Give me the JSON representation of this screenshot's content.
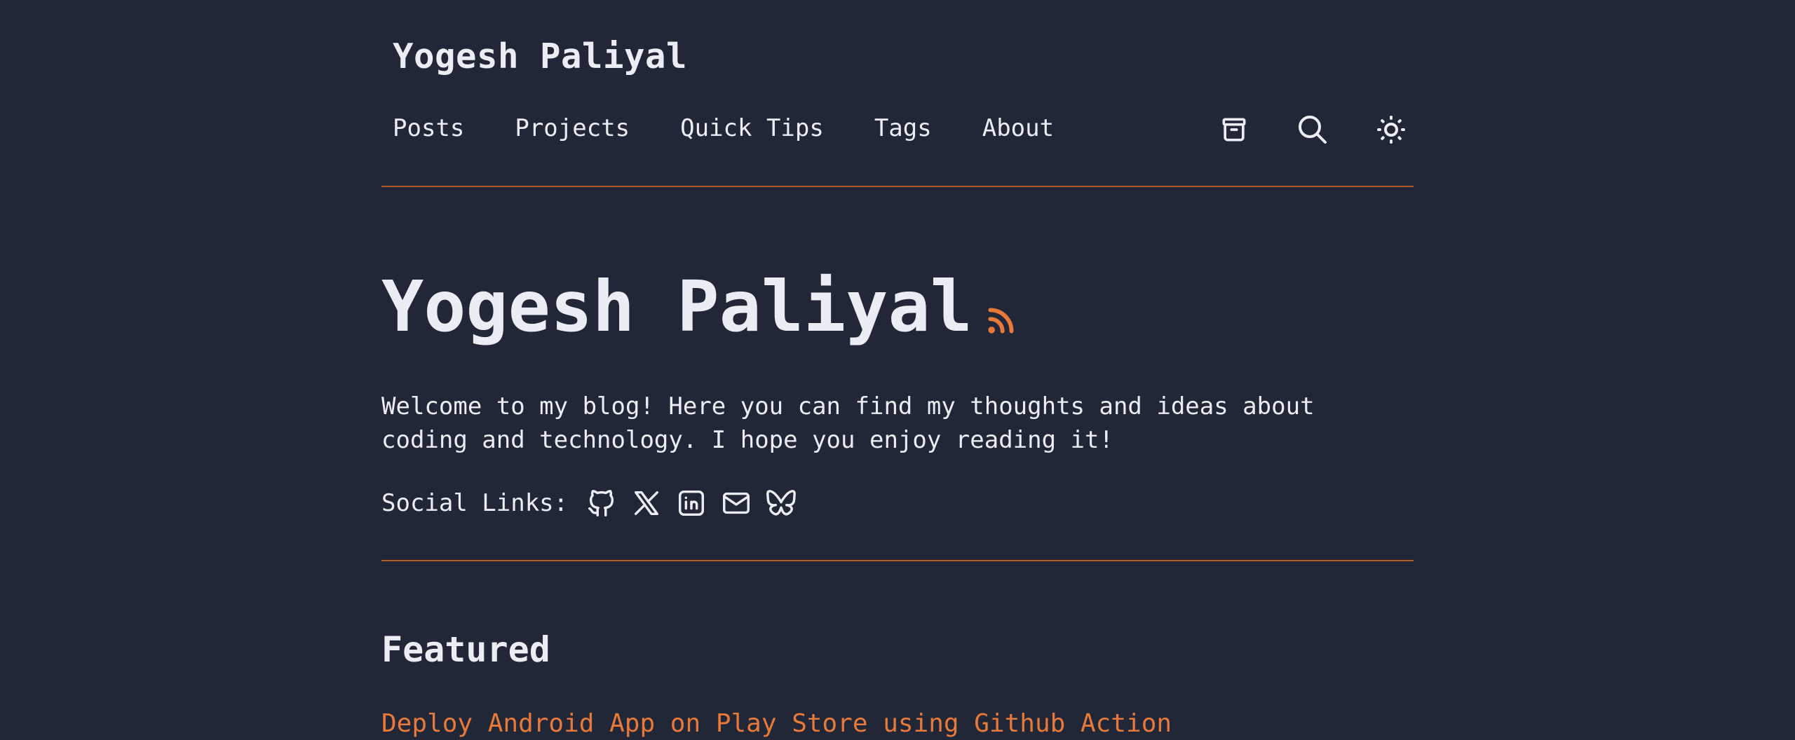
{
  "header": {
    "site_title": "Yogesh Paliyal",
    "nav": [
      {
        "label": "Posts"
      },
      {
        "label": "Projects"
      },
      {
        "label": "Quick Tips"
      },
      {
        "label": "Tags"
      },
      {
        "label": "About"
      }
    ],
    "icons": [
      "archive-icon",
      "search-icon",
      "sun-icon"
    ]
  },
  "hero": {
    "title": "Yogesh Paliyal",
    "rss_icon": "rss-icon",
    "welcome": "Welcome to my blog! Here you can find my thoughts and ideas about coding and technology. I hope you enjoy reading it!"
  },
  "social": {
    "label": "Social Links:",
    "links": [
      "github-icon",
      "x-icon",
      "linkedin-icon",
      "mail-icon",
      "bluesky-icon"
    ]
  },
  "featured": {
    "heading": "Featured",
    "posts": [
      {
        "title": "Deploy Android App on Play Store using Github Action"
      }
    ]
  },
  "colors": {
    "background": "#212737",
    "text": "#eaedf3",
    "accent": "#e7793b",
    "rule": "#ad5b28"
  }
}
